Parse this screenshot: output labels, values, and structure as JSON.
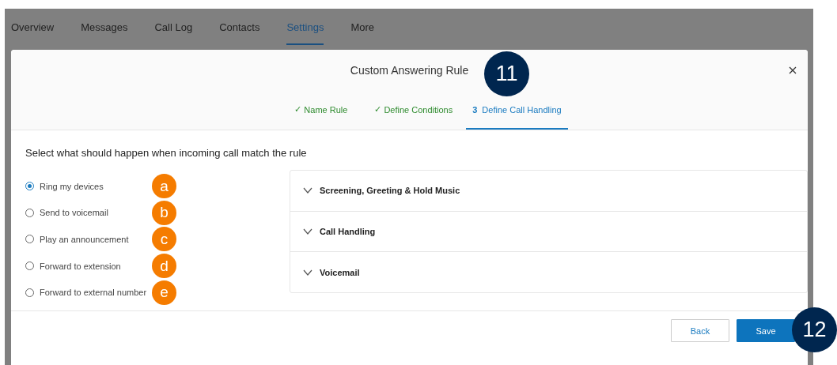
{
  "nav_tabs": [
    {
      "label": "Overview",
      "selected": false
    },
    {
      "label": "Messages",
      "selected": false
    },
    {
      "label": "Call Log",
      "selected": false
    },
    {
      "label": "Contacts",
      "selected": false
    },
    {
      "label": "Settings",
      "selected": true
    },
    {
      "label": "More",
      "selected": false
    }
  ],
  "dialog": {
    "title": "Custom Answering Rule",
    "title_callout": "11",
    "steps": [
      {
        "marker": "✓",
        "label": "Name Rule",
        "completed": true,
        "selected": false
      },
      {
        "marker": "✓",
        "label": "Define Conditions",
        "completed": true,
        "selected": false
      },
      {
        "marker": "3",
        "label": "Define Call Handling",
        "completed": false,
        "selected": true
      }
    ],
    "instruction": "Select what should happen when incoming call match the rule",
    "options": [
      {
        "label": "Ring my devices",
        "selected": true,
        "callout": "a"
      },
      {
        "label": "Send to voicemail",
        "selected": false,
        "callout": "b"
      },
      {
        "label": "Play an announcement",
        "selected": false,
        "callout": "c"
      },
      {
        "label": "Forward to extension",
        "selected": false,
        "callout": "d"
      },
      {
        "label": "Forward to external number",
        "selected": false,
        "callout": "e"
      }
    ],
    "sections": [
      {
        "title": "Screening, Greeting & Hold Music",
        "expanded": false
      },
      {
        "title": "Call Handling",
        "expanded": false
      },
      {
        "title": "Voicemail",
        "expanded": false
      }
    ],
    "buttons": [
      {
        "label": "Back",
        "kind": "secondary"
      },
      {
        "label": "Save",
        "kind": "primary"
      }
    ],
    "footer_callout": "12"
  }
}
